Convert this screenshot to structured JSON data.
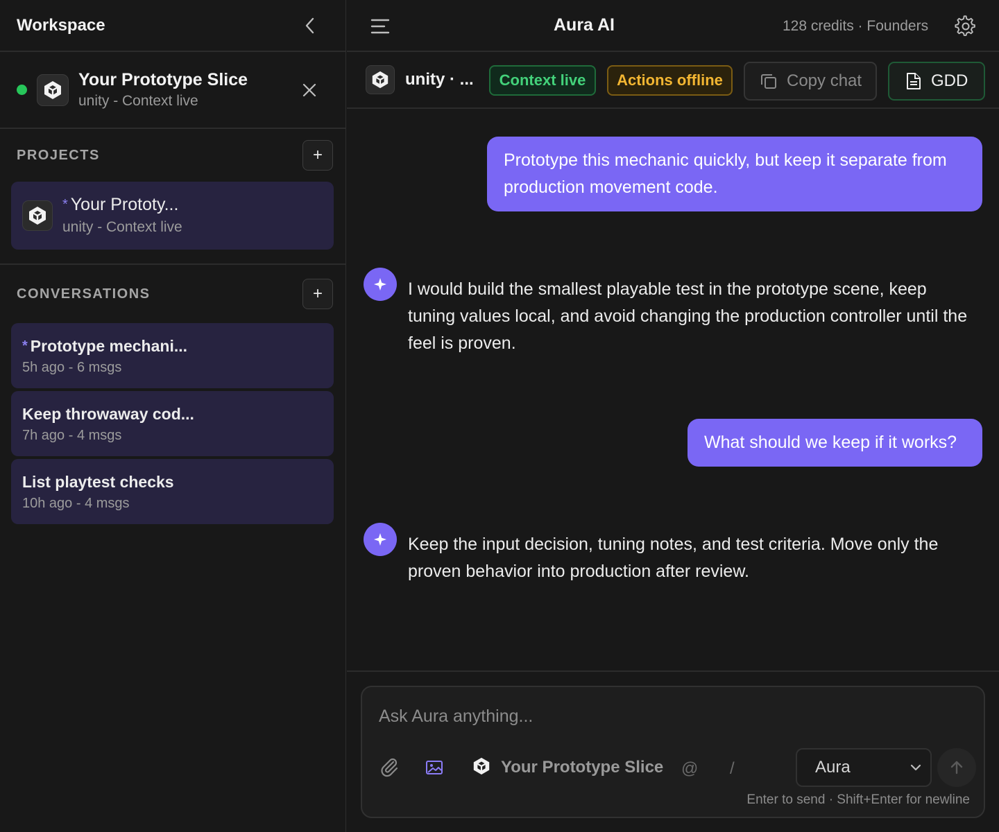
{
  "sidebar": {
    "title": "Workspace",
    "active_project": {
      "name": "Your Prototype Slice",
      "subtitle": "unity - Context live"
    },
    "projects_label": "PROJECTS",
    "projects": [
      {
        "star": "*",
        "name": "Your Prototy...",
        "subtitle": "unity - Context live"
      }
    ],
    "conversations_label": "CONVERSATIONS",
    "conversations": [
      {
        "star": "*",
        "title": "Prototype mechani...",
        "meta": "5h ago - 6 msgs"
      },
      {
        "title": "Keep throwaway cod...",
        "meta": "7h ago - 4 msgs"
      },
      {
        "title": "List playtest checks",
        "meta": "10h ago - 4 msgs"
      }
    ],
    "add_label": "+"
  },
  "header": {
    "title": "Aura AI",
    "credits": "128 credits · Founders"
  },
  "context": {
    "engine_label": "unity · ...",
    "badge_live": "Context live",
    "badge_offline": "Actions offline",
    "copy_label": "Copy chat",
    "gdd_label": "GDD"
  },
  "messages": [
    {
      "role": "user",
      "text": "Prototype this mechanic quickly, but keep it separate from production movement code."
    },
    {
      "role": "assistant",
      "text": "I would build the smallest playable test in the prototype scene, keep tuning values local, and avoid changing the production controller until the feel is proven."
    },
    {
      "role": "user",
      "text": "What should we keep if it works?"
    },
    {
      "role": "assistant",
      "text": "Keep the input decision, tuning notes, and test criteria. Move only the proven behavior into production after review."
    }
  ],
  "composer": {
    "placeholder": "Ask Aura anything...",
    "project_chip": "Your Prototype Slice",
    "at_symbol": "@",
    "slash_symbol": "/",
    "model": "Aura",
    "hint": "Enter to send · Shift+Enter for newline"
  },
  "colors": {
    "accent": "#7a67f4",
    "live_green": "#43d17a",
    "offline_amber": "#f3b632",
    "status_dot": "#27c65a",
    "card_bg": "#272340"
  },
  "icons": [
    "chevron-left-icon",
    "close-icon",
    "unity-icon",
    "plus-icon",
    "menu-icon",
    "gear-icon",
    "copy-icon",
    "document-icon",
    "sparkle-icon",
    "paperclip-icon",
    "image-icon",
    "chevron-down-icon",
    "arrow-up-icon"
  ]
}
